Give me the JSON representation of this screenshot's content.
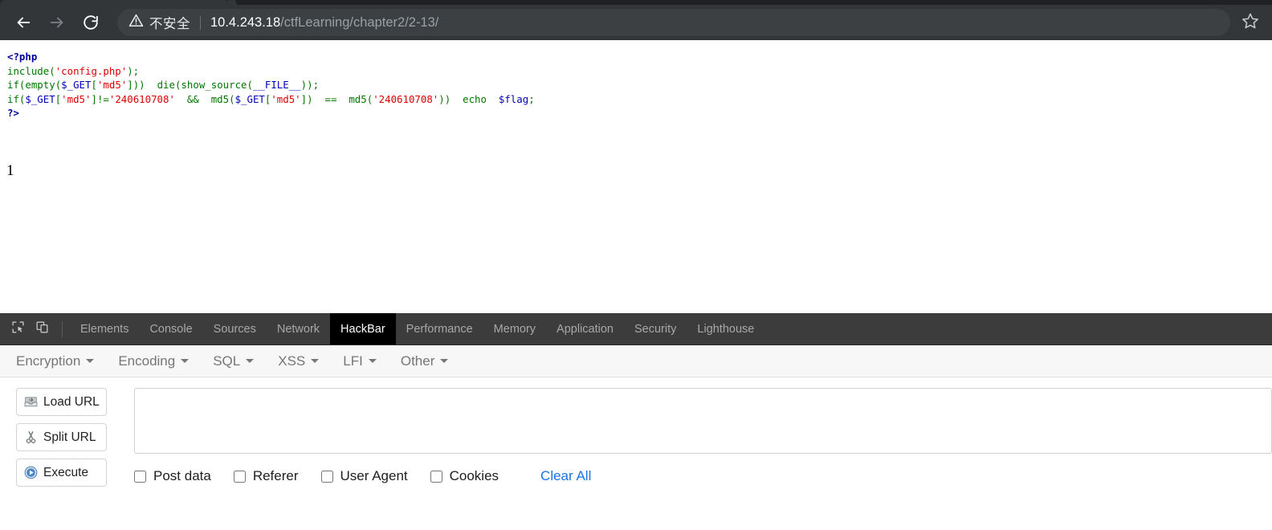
{
  "browser": {
    "nav": {
      "back_icon": "arrow-left-icon",
      "forward_icon": "arrow-right-icon",
      "reload_icon": "reload-icon"
    },
    "omnibox": {
      "security_icon": "warning-triangle-icon",
      "security_label": "不安全",
      "url_host": "10.4.243.18",
      "url_path": "/ctfLearning/chapter2/2-13/",
      "full_url": "10.4.243.18/ctfLearning/chapter2/2-13/"
    },
    "bookmark_icon": "star-outline-icon"
  },
  "page": {
    "code_lines": [
      {
        "tokens": [
          {
            "t": "<?php",
            "c": "php-tag"
          }
        ]
      },
      {
        "tokens": [
          {
            "t": "include",
            "c": "kw"
          },
          {
            "t": "(",
            "c": "kw"
          },
          {
            "t": "'config.php'",
            "c": "str"
          },
          {
            "t": ");",
            "c": "kw"
          }
        ]
      },
      {
        "tokens": [
          {
            "t": "if",
            "c": "kw"
          },
          {
            "t": "(",
            "c": "kw"
          },
          {
            "t": "empty",
            "c": "kw"
          },
          {
            "t": "(",
            "c": "kw"
          },
          {
            "t": "$_GET",
            "c": "def"
          },
          {
            "t": "[",
            "c": "kw"
          },
          {
            "t": "'md5'",
            "c": "str"
          },
          {
            "t": "]))  ",
            "c": "kw"
          },
          {
            "t": "die",
            "c": "kw"
          },
          {
            "t": "(",
            "c": "kw"
          },
          {
            "t": "show_source",
            "c": "kw"
          },
          {
            "t": "(",
            "c": "kw"
          },
          {
            "t": "__FILE__",
            "c": "def"
          },
          {
            "t": "));",
            "c": "kw"
          }
        ]
      },
      {
        "tokens": [
          {
            "t": "if",
            "c": "kw"
          },
          {
            "t": "(",
            "c": "kw"
          },
          {
            "t": "$_GET",
            "c": "def"
          },
          {
            "t": "[",
            "c": "kw"
          },
          {
            "t": "'md5'",
            "c": "str"
          },
          {
            "t": "]!=",
            "c": "kw"
          },
          {
            "t": "'240610708'",
            "c": "str"
          },
          {
            "t": "  && ",
            "c": "kw"
          },
          {
            "t": " md5",
            "c": "kw"
          },
          {
            "t": "(",
            "c": "kw"
          },
          {
            "t": "$_GET",
            "c": "def"
          },
          {
            "t": "[",
            "c": "kw"
          },
          {
            "t": "'md5'",
            "c": "str"
          },
          {
            "t": "])  ==  ",
            "c": "kw"
          },
          {
            "t": "md5",
            "c": "kw"
          },
          {
            "t": "(",
            "c": "kw"
          },
          {
            "t": "'240610708'",
            "c": "str"
          },
          {
            "t": "))  ",
            "c": "kw"
          },
          {
            "t": "echo",
            "c": "kw"
          },
          {
            "t": "  ",
            "c": "kw"
          },
          {
            "t": "$flag",
            "c": "def"
          },
          {
            "t": ";",
            "c": "kw"
          }
        ]
      },
      {
        "tokens": [
          {
            "t": "?>",
            "c": "php-tag"
          }
        ]
      }
    ],
    "output_text": "1"
  },
  "devtools": {
    "inspect_icon": "inspect-cursor-icon",
    "device_icon": "device-toolbar-icon",
    "tabs": [
      {
        "label": "Elements",
        "active": false
      },
      {
        "label": "Console",
        "active": false
      },
      {
        "label": "Sources",
        "active": false
      },
      {
        "label": "Network",
        "active": false
      },
      {
        "label": "HackBar",
        "active": true
      },
      {
        "label": "Performance",
        "active": false
      },
      {
        "label": "Memory",
        "active": false
      },
      {
        "label": "Application",
        "active": false
      },
      {
        "label": "Security",
        "active": false
      },
      {
        "label": "Lighthouse",
        "active": false
      }
    ]
  },
  "hackbar": {
    "menus": [
      {
        "label": "Encryption"
      },
      {
        "label": "Encoding"
      },
      {
        "label": "SQL"
      },
      {
        "label": "XSS"
      },
      {
        "label": "LFI"
      },
      {
        "label": "Other"
      }
    ],
    "buttons": [
      {
        "label": "Load URL",
        "icon": "load-url-icon"
      },
      {
        "label": "Split URL",
        "icon": "split-url-scissors-icon"
      },
      {
        "label": "Execute",
        "icon": "execute-play-icon"
      }
    ],
    "url_textarea": {
      "value": "",
      "placeholder": ""
    },
    "checkboxes": [
      {
        "label": "Post data",
        "checked": false
      },
      {
        "label": "Referer",
        "checked": false
      },
      {
        "label": "User Agent",
        "checked": false
      },
      {
        "label": "Cookies",
        "checked": false
      }
    ],
    "clear_all_label": "Clear All",
    "accent_color": "#1a73e8"
  }
}
